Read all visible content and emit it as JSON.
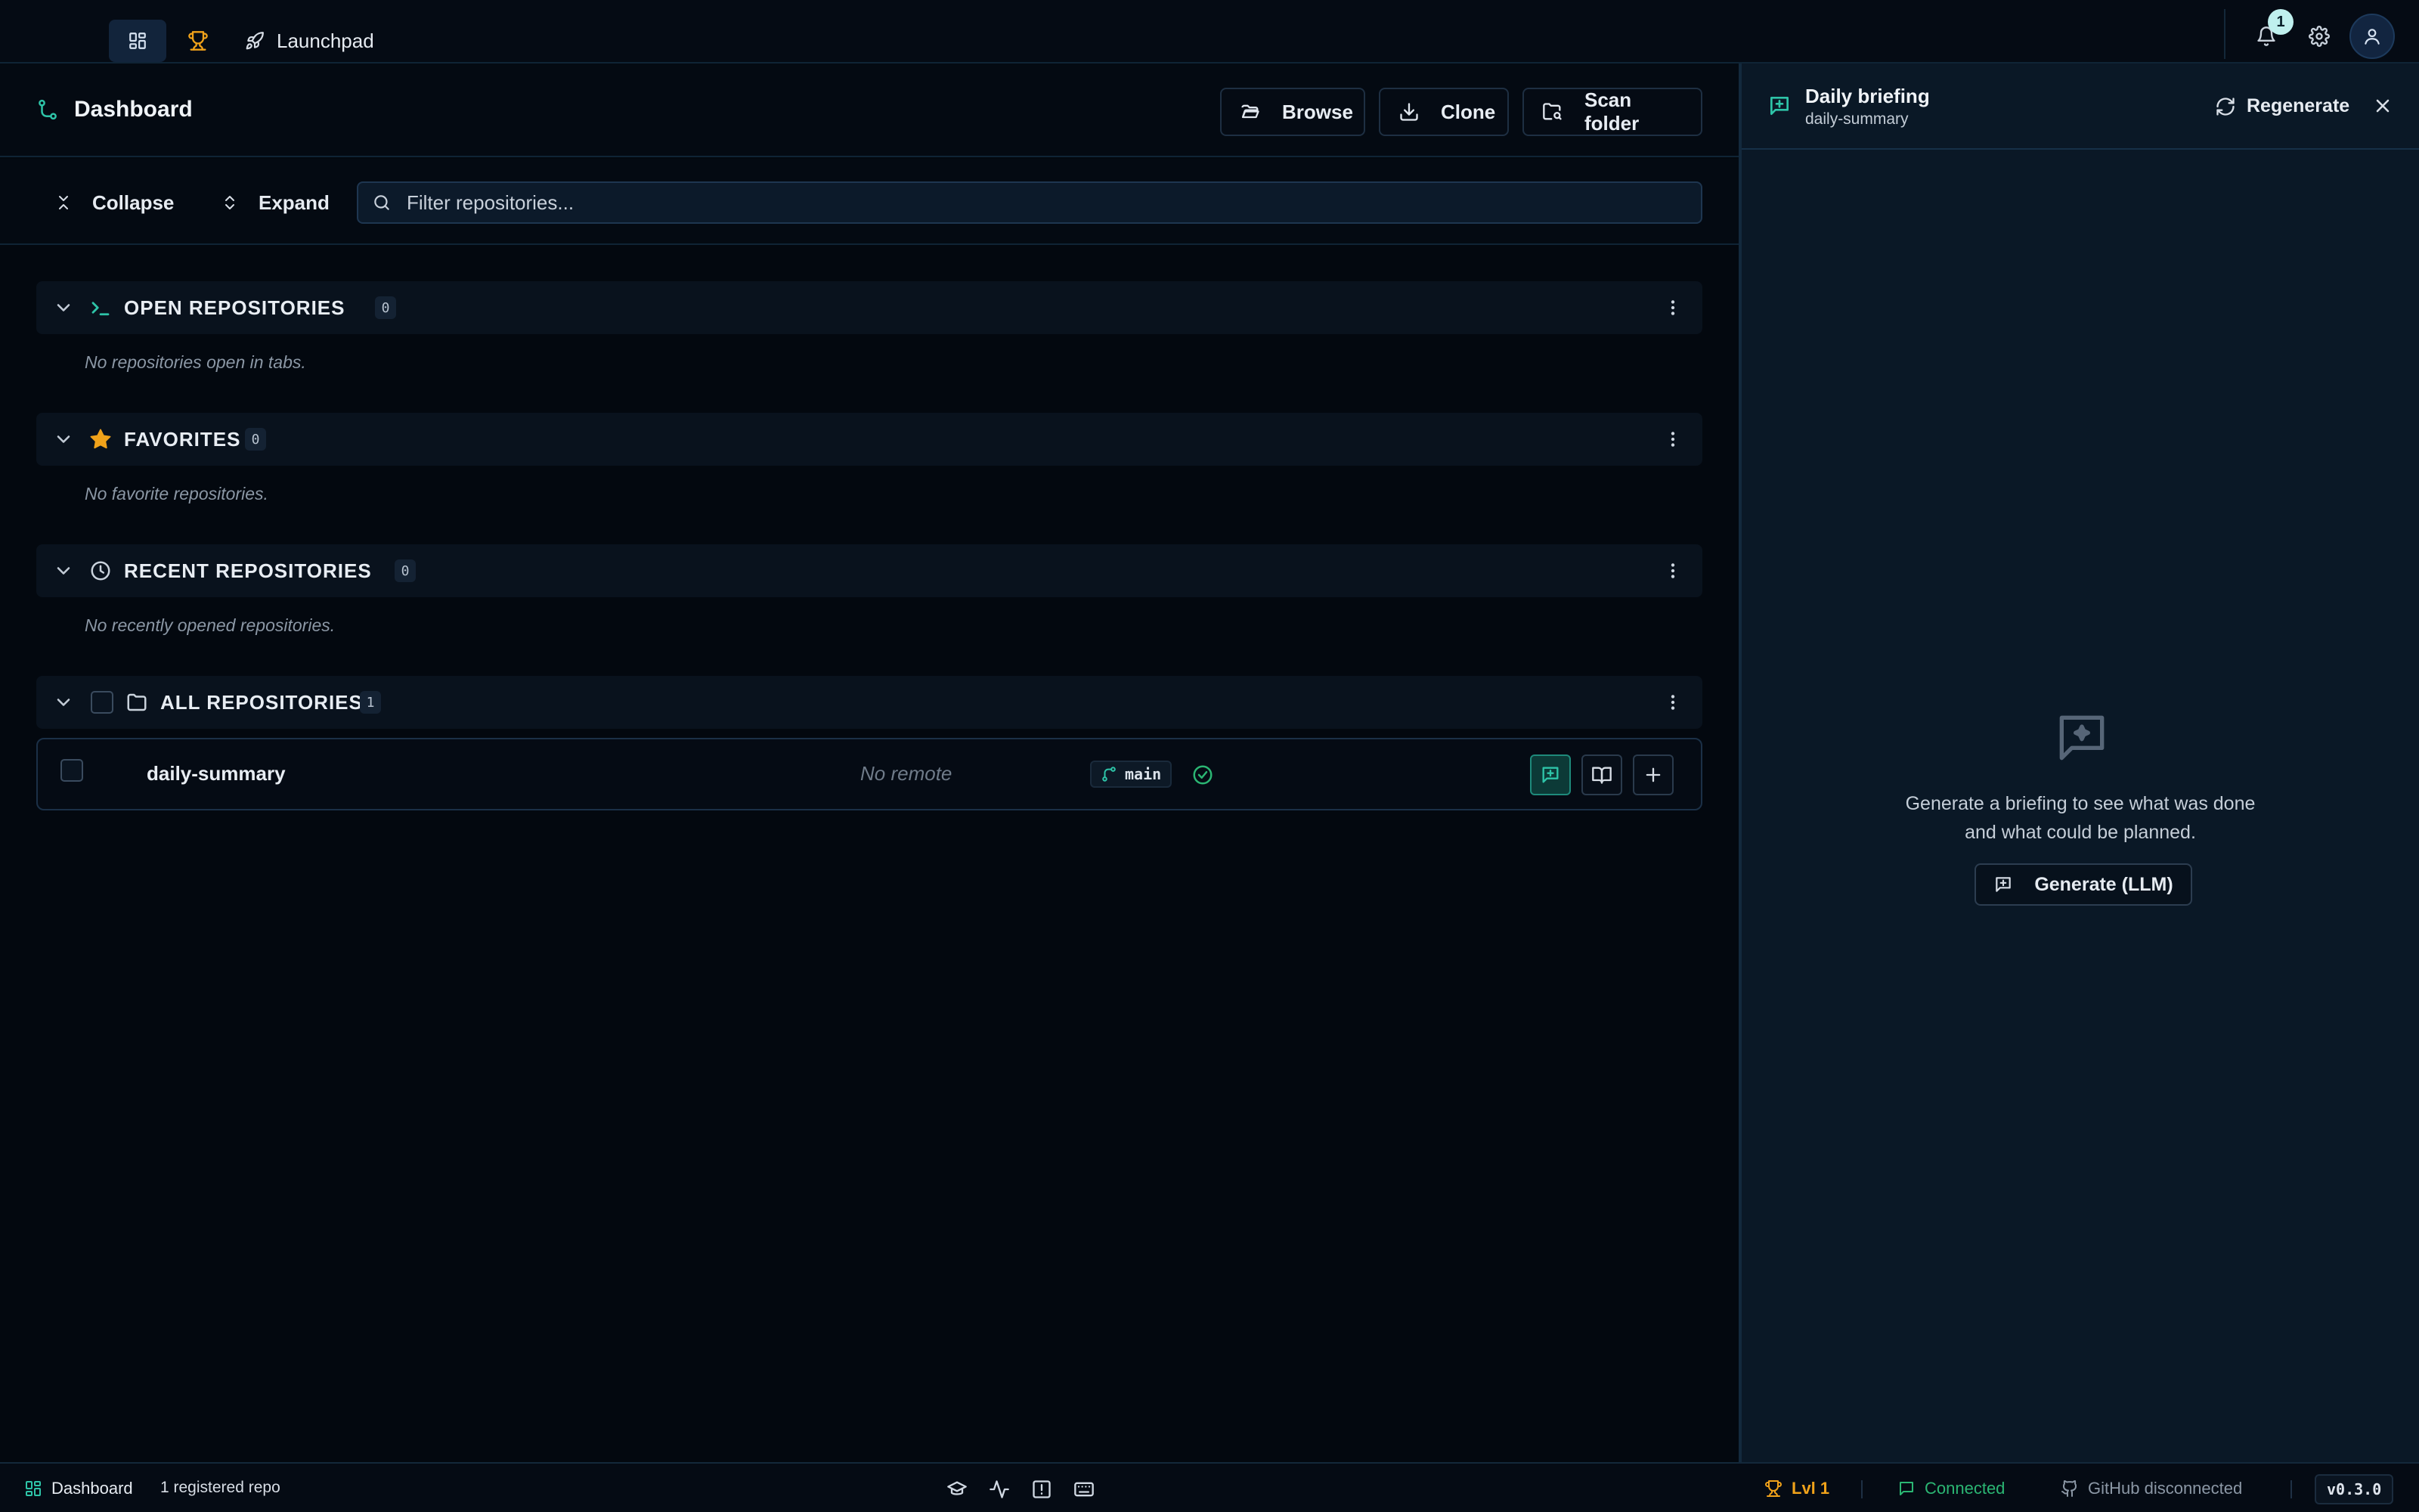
{
  "topbar": {
    "launchpad_label": "Launchpad",
    "notification_count": "1"
  },
  "header": {
    "title": "Dashboard",
    "browse_label": "Browse",
    "clone_label": "Clone",
    "scan_label": "Scan folder"
  },
  "toolbar": {
    "collapse_label": "Collapse",
    "expand_label": "Expand",
    "filter_placeholder": "Filter repositories..."
  },
  "sections": {
    "open": {
      "label": "OPEN REPOSITORIES",
      "count": "0",
      "empty": "No repositories open in tabs."
    },
    "favorites": {
      "label": "FAVORITES",
      "count": "0",
      "empty": "No favorite repositories."
    },
    "recent": {
      "label": "RECENT REPOSITORIES",
      "count": "0",
      "empty": "No recently opened repositories."
    },
    "all": {
      "label": "ALL REPOSITORIES",
      "count": "1"
    }
  },
  "repos": [
    {
      "name": "daily-summary",
      "remote": "No remote",
      "branch": "main",
      "status": "clean"
    }
  ],
  "panel": {
    "title": "Daily briefing",
    "subtitle": "daily-summary",
    "regenerate_label": "Regenerate",
    "empty_line1": "Generate a briefing to see what was done",
    "empty_line2": "and what could be planned.",
    "generate_label": "Generate (LLM)"
  },
  "statusbar": {
    "page": "Dashboard",
    "repo_count": "1 registered repo",
    "level": "Lvl 1",
    "connection": "Connected",
    "github": "GitHub disconnected",
    "version": "v0.3.0"
  },
  "colors": {
    "accent": "#2ec4a8",
    "warning": "#f0a21a",
    "success": "#2bb673",
    "background": "#03080f",
    "panel": "#0a1826"
  },
  "icons": {
    "topbar": [
      "dashboard-grid-icon",
      "trophy-icon",
      "rocket-icon",
      "bell-icon",
      "gear-icon",
      "user-icon"
    ],
    "header": [
      "git-branch-icon",
      "folder-open-icon",
      "download-icon",
      "folder-search-icon"
    ],
    "sections": [
      "terminal-icon",
      "star-icon",
      "clock-icon",
      "folder-icon"
    ],
    "repo_actions": [
      "chat-icon",
      "book-icon",
      "plus-icon"
    ],
    "statusbar": [
      "graduation-cap-icon",
      "activity-icon",
      "alert-square-icon",
      "keyboard-icon"
    ]
  }
}
